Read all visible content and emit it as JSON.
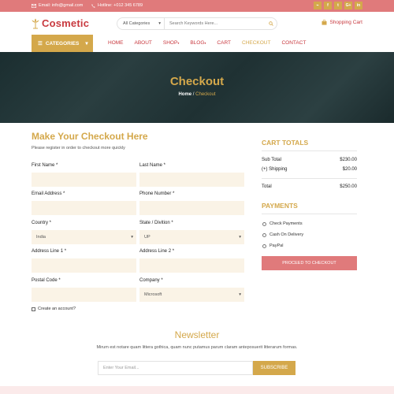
{
  "topbar": {
    "email": "Email: info@gmail.com",
    "hotline": "Hotline: +012 345 6789",
    "socials": [
      "rss",
      "facebook",
      "twitter",
      "google-plus",
      "linkedin"
    ],
    "social_glyphs": [
      "⌁",
      "f",
      "t",
      "G+",
      "in"
    ]
  },
  "header": {
    "logo_text": "Cosmetic",
    "search": {
      "category": "All Categories",
      "placeholder": "Search Keywords Here..."
    },
    "cart_label": "Shopping Cart"
  },
  "nav": {
    "categories_label": "CATEGORIES",
    "items": [
      {
        "label": "HOME",
        "active": false
      },
      {
        "label": "ABOUT",
        "active": false
      },
      {
        "label": "SHOP",
        "active": false,
        "dropdown": true
      },
      {
        "label": "BLOG",
        "active": false,
        "dropdown": true
      },
      {
        "label": "CART",
        "active": false
      },
      {
        "label": "CHECKOUT",
        "active": true
      },
      {
        "label": "CONTACT",
        "active": false
      }
    ]
  },
  "hero": {
    "title": "Checkout",
    "crumb_home": "Home",
    "crumb_sep": " / ",
    "crumb_current": "Checkout"
  },
  "checkout": {
    "title": "Make Your Checkout Here",
    "subtitle": "Please register in order to checkout more quickly",
    "fields": {
      "first_name": {
        "label": "First Name *",
        "value": ""
      },
      "last_name": {
        "label": "Last Name *",
        "value": ""
      },
      "email": {
        "label": "Email Address *",
        "value": ""
      },
      "phone": {
        "label": "Phone Number *",
        "value": ""
      },
      "country": {
        "label": "Country *",
        "value": "India"
      },
      "state": {
        "label": "State / Divition *",
        "value": "UP"
      },
      "address1": {
        "label": "Address Line 1 *",
        "value": ""
      },
      "address2": {
        "label": "Address Line 2 *",
        "value": ""
      },
      "postal": {
        "label": "Postal Code *",
        "value": ""
      },
      "company": {
        "label": "Company *",
        "value": "Microsoft"
      }
    },
    "create_account": "Create an account?"
  },
  "cart_totals": {
    "title": "CART TOTALS",
    "sub_total_label": "Sub Total",
    "sub_total_value": "$230.00",
    "shipping_label": "(+) Shipping",
    "shipping_value": "$20.00",
    "total_label": "Total",
    "total_value": "$250.00"
  },
  "payments": {
    "title": "PAYMENTS",
    "options": [
      "Check Payments",
      "Cash On Delivery",
      "PayPal"
    ],
    "proceed_label": "PROCEED TO CHECKOUT"
  },
  "newsletter": {
    "title": "Newsletter",
    "subtitle": "Mirum est notare quam littera gothica, quam nunc putamus parum claram anteposuerit litterarum formas.",
    "placeholder": "Enter Your Email...",
    "button": "SUBSCRIBE"
  },
  "colors": {
    "brand": "#c8393f",
    "accent": "#d4a84b",
    "topbar": "#e07a7b",
    "field_bg": "#faf3e6"
  }
}
